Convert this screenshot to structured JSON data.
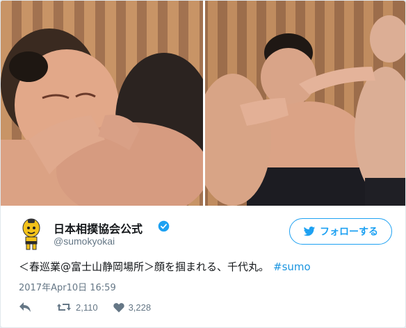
{
  "account": {
    "display_name": "日本相撲協会公式",
    "handle": "@sumokyokai",
    "verified": true
  },
  "follow_button": {
    "label": "フォローする",
    "icon": "twitter-bird-icon"
  },
  "tweet": {
    "text": "＜春巡業@富士山静岡場所＞顔を掴まれる、千代丸。",
    "hashtag": "#sumo",
    "timestamp": "2017年Apr10日 16:59"
  },
  "actions": {
    "reply_icon": "reply-icon",
    "retweet_icon": "retweet-icon",
    "retweet_count": "2,110",
    "like_icon": "heart-icon",
    "like_count": "3,228"
  },
  "colors": {
    "accent": "#1da1f2",
    "hashtag": "#1b95e0",
    "muted": "#657786",
    "verified": "#1da1f2"
  }
}
